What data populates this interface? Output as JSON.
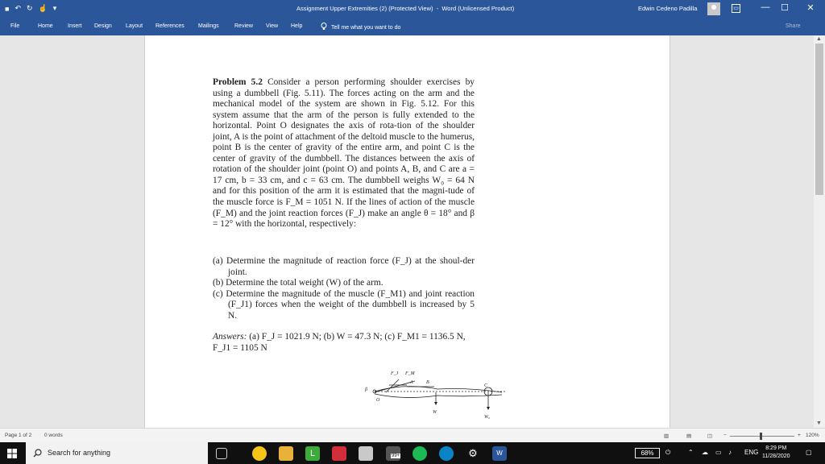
{
  "window": {
    "title": "Assignment Upper Extremities (2) (Protected View)",
    "app": "Word (Unlicensed Product)",
    "user": "Edwin Cedeno Padilla"
  },
  "quick_access": {
    "save": "■",
    "undo": "↶",
    "redo": "↻",
    "touch": "☝",
    "more": "▾"
  },
  "tabs": [
    "File",
    "Home",
    "Insert",
    "Design",
    "Layout",
    "References",
    "Mailings",
    "Review",
    "View",
    "Help"
  ],
  "tell_me": "Tell me what you want to do",
  "share": "Share",
  "document": {
    "problem_label": "Problem 5.2",
    "problem_text": "Consider a person performing shoulder exercises by using a dumbbell (Fig. 5.11). The forces acting on the arm and the mechanical model of the system are shown in Fig. 5.12. For this system assume that the arm of the person is fully extended to the horizontal. Point O designates the axis of rota-tion of the shoulder joint, A is the point of attachment of the deltoid muscle to the humerus, point B is the center of gravity of the entire arm, and point C is the center of gravity of the dumbbell. The distances between the axis of rotation of the shoulder joint (point O) and points A, B, and C are a = 17 cm, b = 33 cm, and c = 63 cm. The dumbbell weighs W₀ = 64 N and for this position of the arm it is estimated that the magni-tude of the muscle force is F_M = 1051 N. If the lines of action of the muscle (F_M) and the joint reaction forces (F_J) make an angle θ = 18° and β = 12° with the horizontal, respectively:",
    "questions": [
      "(a) Determine the magnitude of reaction force (F_J) at the shoul-der joint.",
      "(b) Determine the total weight (W) of the arm.",
      "(c) Determine the magnitude of the muscle (F_M1) and joint reaction (F_J1) forces when the weight of the dumbbell is increased by 5 N."
    ],
    "answers_label": "Answers:",
    "answers_text": "(a) F_J = 1021.9 N; (b) W = 47.3 N; (c) F_M1 = 1136.5 N, F_J1 = 1105 N",
    "figure_labels": {
      "fj": "F_J",
      "fm": "F_M",
      "beta": "β",
      "o": "O",
      "a": "A",
      "b": "B",
      "c": "C",
      "w": "W",
      "wo": "W₀"
    }
  },
  "status": {
    "page": "Page 1 of 2",
    "words": "0 words",
    "zoom": "120%",
    "zoom_minus": "−",
    "zoom_plus": "+"
  },
  "taskbar": {
    "search_placeholder": "Search for anything",
    "battery": "68%",
    "lang": "ENG",
    "time": "8:29 PM",
    "date": "11/28/2020",
    "badge": "99+"
  }
}
